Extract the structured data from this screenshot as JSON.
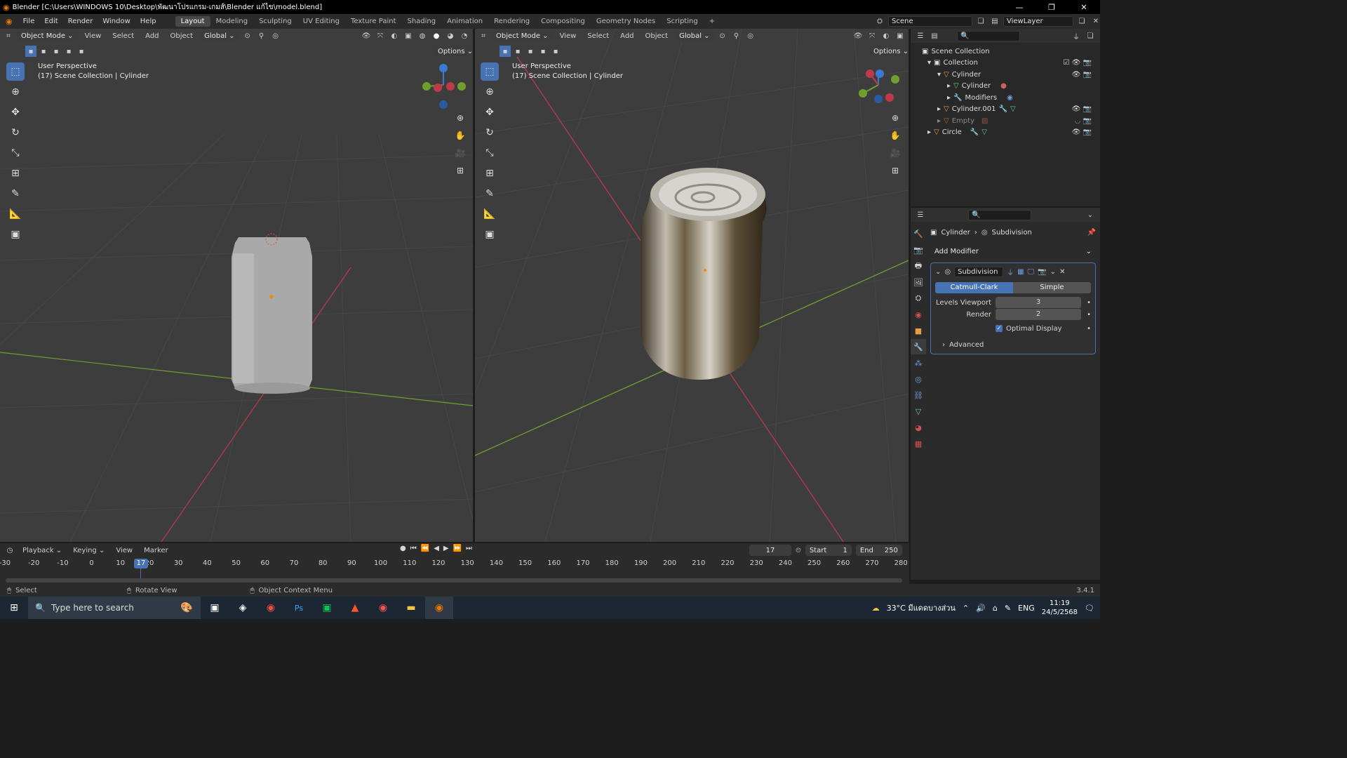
{
  "window": {
    "title": "Blender [C:\\Users\\WINDOWS 10\\Desktop\\พัฒนาโปรแกรม-เกมส์\\Blender แก้ไข\\model.blend]"
  },
  "menu": [
    "File",
    "Edit",
    "Render",
    "Window",
    "Help"
  ],
  "workspaces": [
    "Layout",
    "Modeling",
    "Sculpting",
    "UV Editing",
    "Texture Paint",
    "Shading",
    "Animation",
    "Rendering",
    "Compositing",
    "Geometry Nodes",
    "Scripting"
  ],
  "active_workspace": "Layout",
  "scene": "Scene",
  "view_layer": "ViewLayer",
  "viewport": {
    "mode": "Object Mode",
    "menus": [
      "View",
      "Select",
      "Add",
      "Object"
    ],
    "transform": "Global",
    "options": "Options",
    "label1": "User Perspective",
    "label2": "(17) Scene Collection | Cylinder"
  },
  "outliner": {
    "root": "Scene Collection",
    "rows": [
      {
        "name": "Collection",
        "indent": 1
      },
      {
        "name": "Cylinder",
        "indent": 2
      },
      {
        "name": "Cylinder",
        "indent": 3
      },
      {
        "name": "Modifiers",
        "indent": 3
      },
      {
        "name": "Cylinder.001",
        "indent": 2
      },
      {
        "name": "Empty",
        "indent": 2
      },
      {
        "name": "Circle",
        "indent": 1
      }
    ]
  },
  "properties": {
    "breadcrumb_object": "Cylinder",
    "breadcrumb_modifier": "Subdivision",
    "add_modifier": "Add Modifier",
    "modifier_name": "Subdivision",
    "mode_a": "Catmull-Clark",
    "mode_b": "Simple",
    "levels_label": "Levels Viewport",
    "levels_value": "3",
    "render_label": "Render",
    "render_value": "2",
    "optimal": "Optimal Display",
    "advanced": "Advanced"
  },
  "timeline": {
    "menus": [
      "Playback",
      "Keying",
      "View",
      "Marker"
    ],
    "current": "17",
    "start_label": "Start",
    "start": "1",
    "end_label": "End",
    "end": "250",
    "ticks": [
      "-30",
      "-20",
      "-10",
      "0",
      "10",
      "20",
      "30",
      "40",
      "50",
      "60",
      "70",
      "80",
      "90",
      "100",
      "110",
      "120",
      "130",
      "140",
      "150",
      "160",
      "170",
      "180",
      "190",
      "200",
      "210",
      "220",
      "230",
      "240",
      "250",
      "260",
      "270",
      "280"
    ],
    "frame_marker": "17"
  },
  "status": {
    "select": "Select",
    "rotate": "Rotate View",
    "context": "Object Context Menu",
    "version": "3.4.1"
  },
  "taskbar": {
    "search": "Type here to search",
    "weather": "33°C มีแดดบางส่วน",
    "lang": "ENG",
    "time": "11:19",
    "date": "24/5/2568"
  },
  "colors": {
    "accent": "#4772b3",
    "xaxis": "#c0394b",
    "yaxis": "#6ea02e"
  }
}
